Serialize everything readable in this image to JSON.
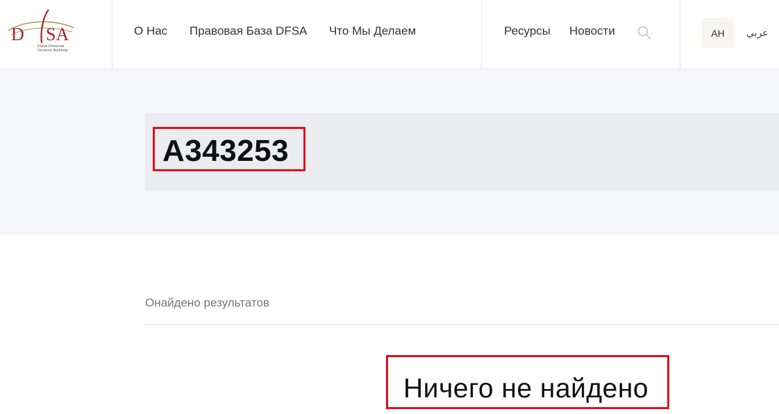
{
  "header": {
    "logo": {
      "mark": "DFSA",
      "caption_line1": "Dubai Financial",
      "caption_line2": "Services Authority"
    },
    "nav_left": [
      {
        "label": "О Нас"
      },
      {
        "label": "Правовая База DFSA"
      },
      {
        "label": "Что Мы Делаем"
      }
    ],
    "nav_right": [
      {
        "label": "Ресурсы"
      },
      {
        "label": "Новости"
      }
    ],
    "search_icon": "search-icon",
    "lang_current": "АН",
    "lang_alt": "عربي"
  },
  "search": {
    "query": "A343253",
    "results_label": "Онайдено результатов",
    "empty_message": "Ничего не найдено"
  },
  "colors": {
    "brand_red": "#a8232b",
    "brand_gold": "#b8975a",
    "highlight": "#e0101a",
    "hero_bg": "#f5f6f9",
    "query_strip_bg": "#ebecf0",
    "lang_bg": "#f7f5f0"
  }
}
